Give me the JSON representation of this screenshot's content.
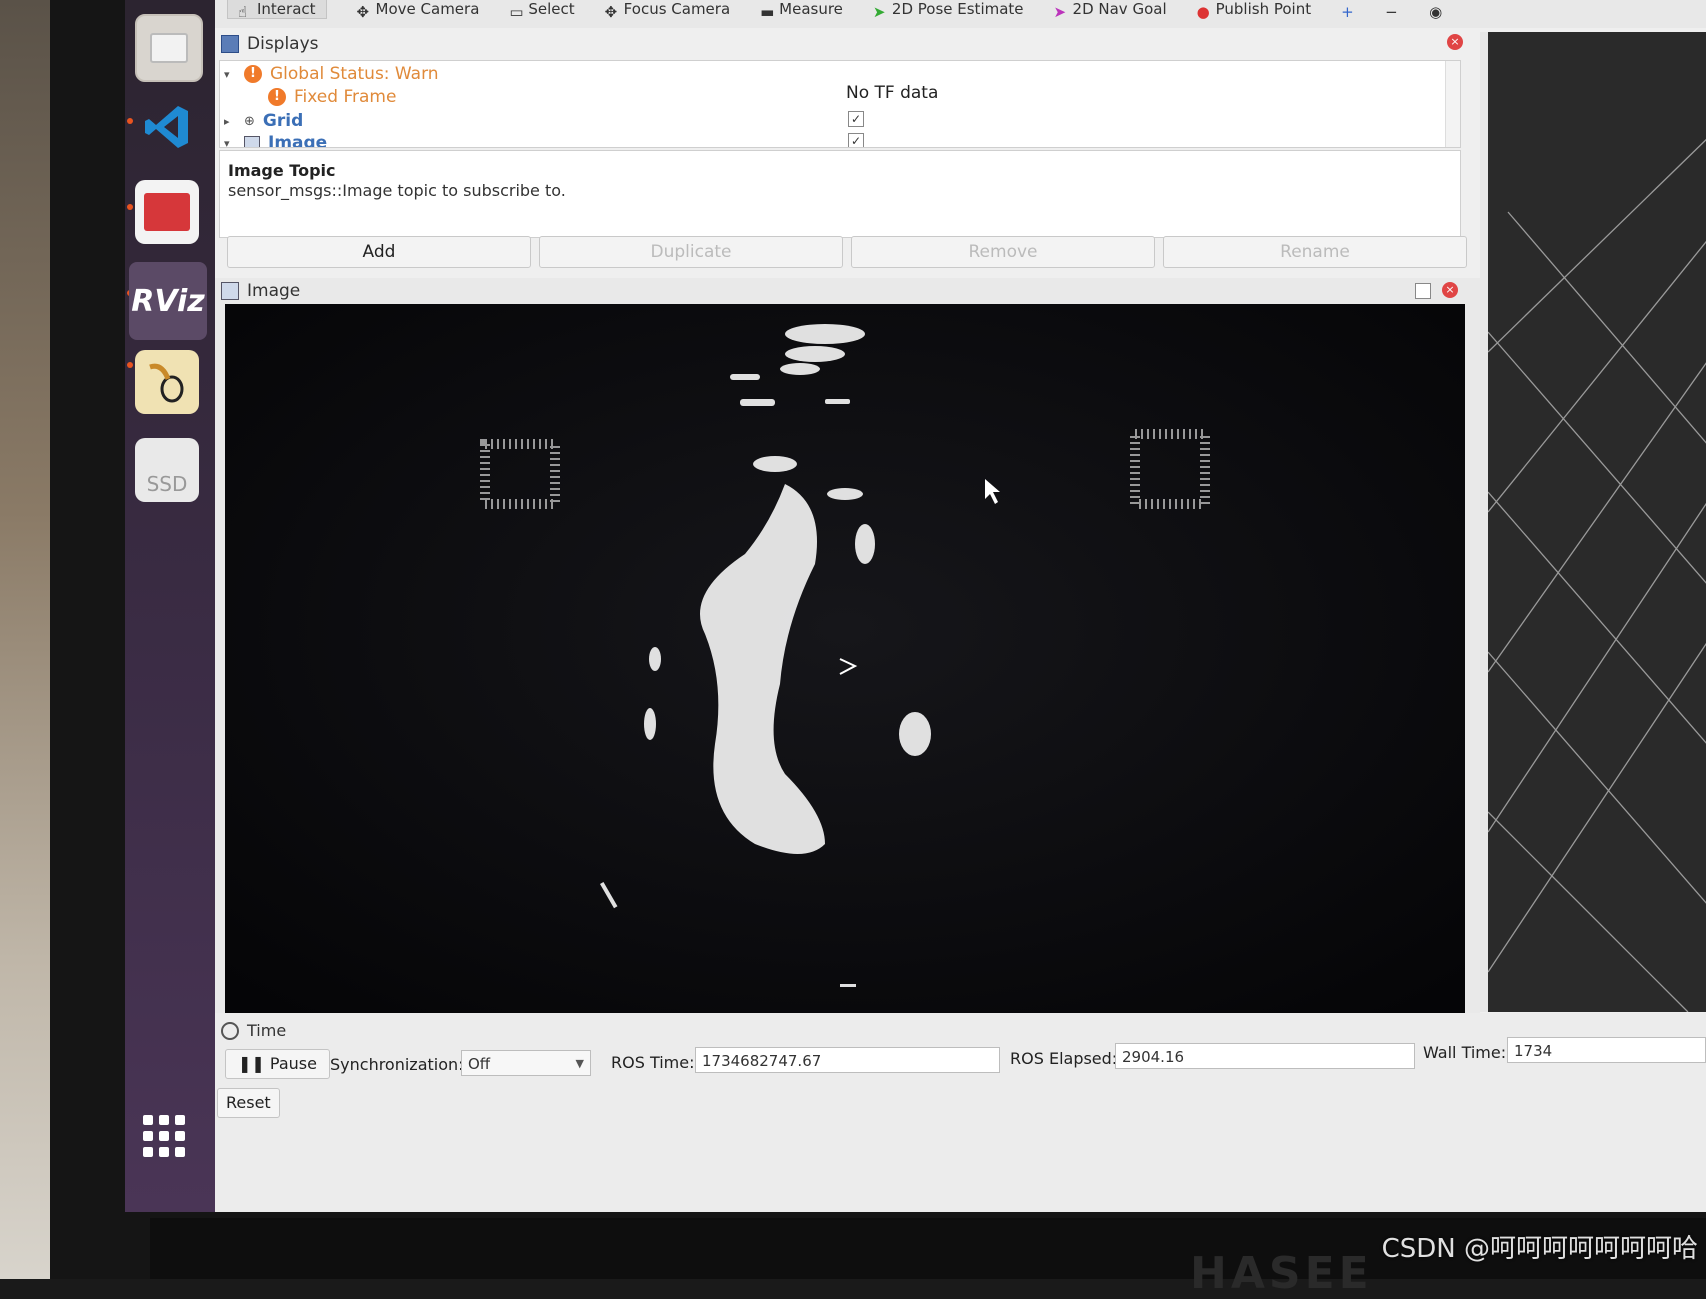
{
  "toolbar": {
    "tools": [
      {
        "label": "Interact"
      },
      {
        "label": "Move Camera"
      },
      {
        "label": "Select"
      },
      {
        "label": "Focus Camera"
      },
      {
        "label": "Measure"
      },
      {
        "label": "2D Pose Estimate"
      },
      {
        "label": "2D Nav Goal"
      },
      {
        "label": "Publish Point"
      }
    ]
  },
  "displays": {
    "title": "Displays",
    "tree": {
      "global_status": "Global Status: Warn",
      "fixed_frame": "Fixed Frame",
      "fixed_frame_value": "No TF data",
      "grid": "Grid",
      "image": "Image"
    },
    "description": {
      "title": "Image Topic",
      "body": "sensor_msgs::Image topic to subscribe to."
    },
    "buttons": {
      "add": "Add",
      "duplicate": "Duplicate",
      "remove": "Remove",
      "rename": "Rename"
    }
  },
  "image_panel": {
    "title": "Image"
  },
  "time_panel": {
    "title": "Time",
    "pause": "Pause",
    "sync_label": "Synchronization:",
    "sync_value": "Off",
    "ros_time_label": "ROS Time:",
    "ros_time_value": "1734682747.67",
    "ros_elapsed_label": "ROS Elapsed:",
    "ros_elapsed_value": "2904.16",
    "wall_time_label": "Wall Time:",
    "wall_time_value": "1734",
    "reset": "Reset"
  },
  "dock": {
    "rviz_label": "RViz",
    "ssd_label": "SSD"
  },
  "screen_brand": "HASEE",
  "watermark": "CSDN @呵呵呵呵呵呵呵哈",
  "colors": {
    "warn": "#f07a2a",
    "link_blue": "#3b6fb6",
    "dock_active": "#e95420"
  }
}
